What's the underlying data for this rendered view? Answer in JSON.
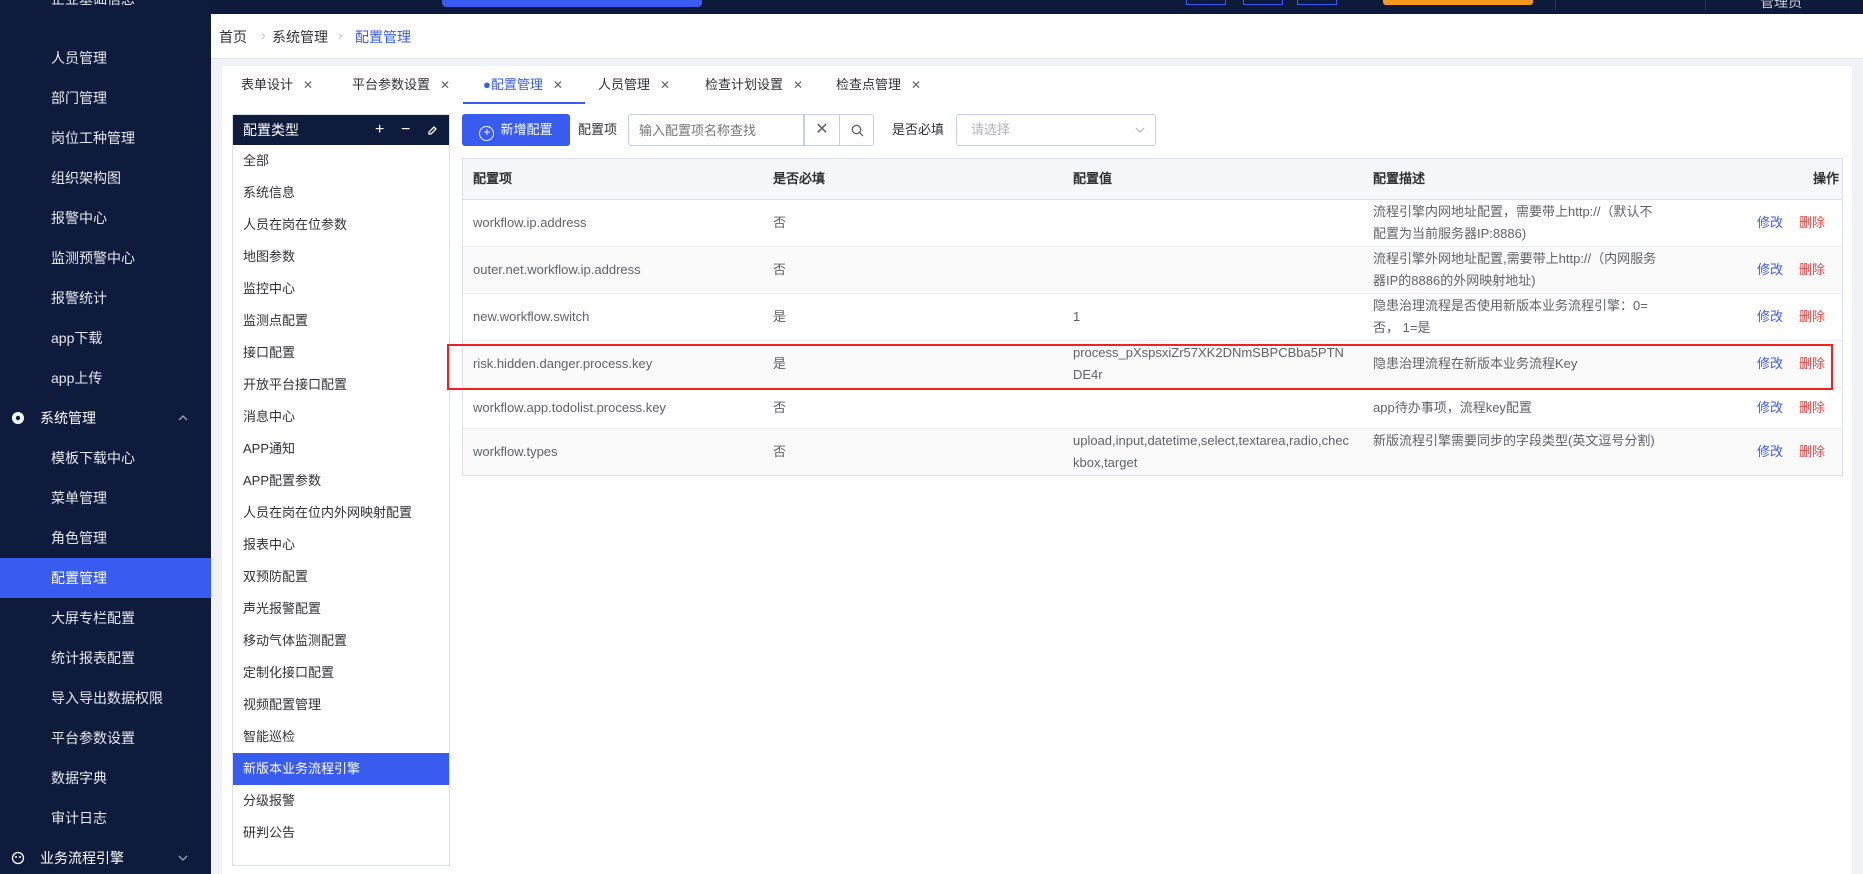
{
  "topbar": {
    "user_label": "管理员"
  },
  "sidebar": {
    "items_top": [
      "企业基础信息",
      "人员管理",
      "部门管理",
      "岗位工种管理",
      "组织架构图",
      "报警中心",
      "监测预警中心",
      "报警统计",
      "app下载",
      "app上传"
    ],
    "group_system": "系统管理",
    "items_system": [
      "模板下载中心",
      "菜单管理",
      "角色管理",
      "配置管理",
      "大屏专栏配置",
      "统计报表配置",
      "导入导出数据权限",
      "平台参数设置",
      "数据字典",
      "审计日志"
    ],
    "group_workflow": "业务流程引擎",
    "active_item": "配置管理"
  },
  "breadcrumb": [
    "首页",
    "系统管理",
    "配置管理"
  ],
  "tabs": [
    {
      "label": "表单设计"
    },
    {
      "label": "平台参数设置"
    },
    {
      "label": "●配置管理"
    },
    {
      "label": "人员管理"
    },
    {
      "label": "检查计划设置"
    },
    {
      "label": "检查点管理"
    }
  ],
  "tab_close": "✕",
  "type_panel": {
    "title": "配置类型",
    "items": [
      "全部",
      "系统信息",
      "人员在岗在位参数",
      "地图参数",
      "监控中心",
      "监测点配置",
      "接口配置",
      "开放平台接口配置",
      "消息中心",
      "APP通知",
      "APP配置参数",
      "人员在岗在位内外网映射配置",
      "报表中心",
      "双预防配置",
      "声光报警配置",
      "移动气体监测配置",
      "定制化接口配置",
      "视频配置管理",
      "智能巡检",
      "新版本业务流程引擎",
      "分级报警",
      "研判公告"
    ],
    "active": "新版本业务流程引擎"
  },
  "toolbar": {
    "add_label": "新增配置",
    "item_label": "配置项",
    "search_placeholder": "输入配置项名称查找",
    "required_label": "是否必填",
    "select_placeholder": "请选择"
  },
  "table": {
    "headers": {
      "key": "配置项",
      "required": "是否必填",
      "value": "配置值",
      "desc": "配置描述",
      "ops": "操作"
    },
    "edit_label": "修改",
    "delete_label": "删除",
    "rows": [
      {
        "key": "workflow.ip.address",
        "required": "否",
        "value": "",
        "desc": "流程引擎内网地址配置，需要带上http://（默认不配置为当前服务器IP:8886)"
      },
      {
        "key": "outer.net.workflow.ip.address",
        "required": "否",
        "value": "",
        "desc": "流程引擎外网地址配置,需要带上http://（内网服务器IP的8886的外网映射地址)"
      },
      {
        "key": "new.workflow.switch",
        "required": "是",
        "value": "1",
        "desc": "隐患治理流程是否使用新版本业务流程引擎：0=否， 1=是"
      },
      {
        "key": "risk.hidden.danger.process.key",
        "required": "是",
        "value": "process_pXspsxiZr57XK2DNmSBPCBba5PTNDE4r",
        "desc": "隐患治理流程在新版本业务流程Key"
      },
      {
        "key": "workflow.app.todolist.process.key",
        "required": "否",
        "value": "",
        "desc": "app待办事项，流程key配置"
      },
      {
        "key": "workflow.types",
        "required": "否",
        "value": "upload,input,datetime,select,textarea,radio,checkbox,target",
        "desc": "新版流程引擎需要同步的字段类型(英文逗号分割)"
      }
    ]
  }
}
